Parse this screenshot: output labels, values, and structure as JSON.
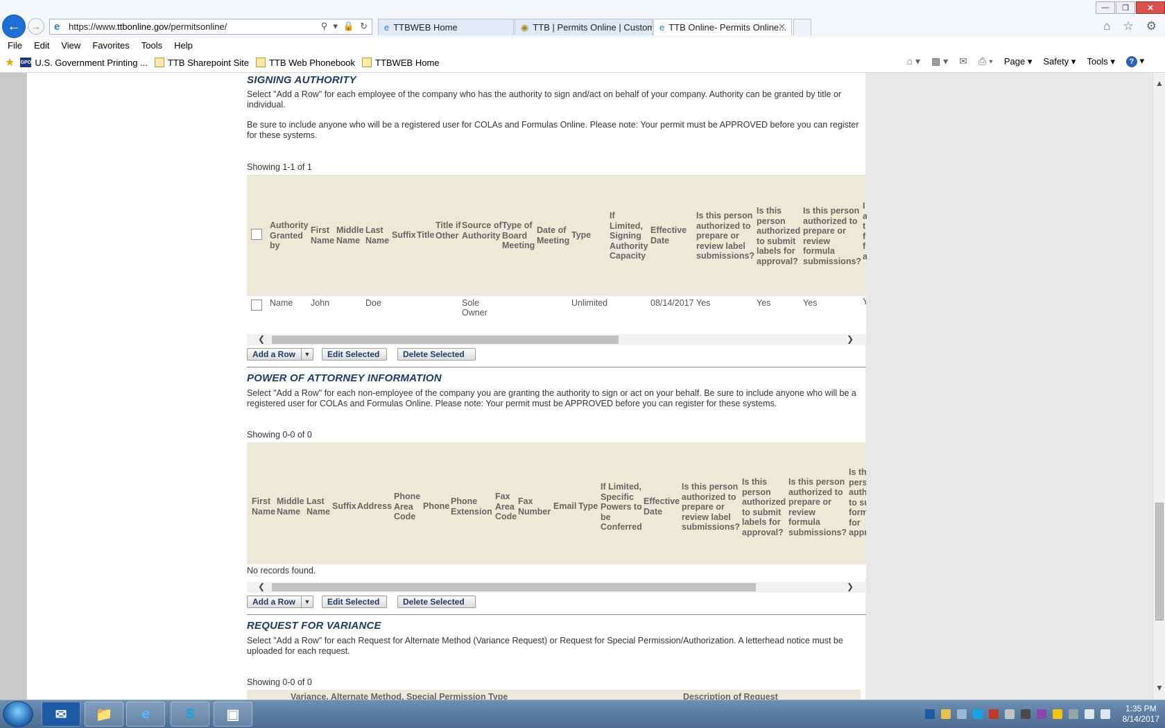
{
  "browser": {
    "url_prefix": "https://www.",
    "url_domain": "ttbonline.gov",
    "url_path": "/permitsonline/",
    "tabs": [
      {
        "label": "TTBWEB Home"
      },
      {
        "label": "TTB | Permits Online | Custom..."
      },
      {
        "label": "TTB Online- Permits Online..."
      }
    ],
    "menu": [
      "File",
      "Edit",
      "View",
      "Favorites",
      "Tools",
      "Help"
    ],
    "favorites": [
      {
        "label": "U.S. Government Printing ..."
      },
      {
        "label": "TTB Sharepoint Site"
      },
      {
        "label": "TTB Web Phonebook"
      },
      {
        "label": "TTBWEB Home"
      }
    ],
    "gpo_badge": "GPO",
    "commands": [
      "Page",
      "Safety",
      "Tools"
    ]
  },
  "signing": {
    "title": "SIGNING AUTHORITY",
    "para1": "Select \"Add a Row\" for each employee of the company who has the authority to sign and/act on behalf of your company. Authority can be granted by title or individual.",
    "para2": "Be sure to include anyone who will be a registered user for COLAs and Formulas Online. Please note: Your permit must be APPROVED before you can register for these systems.",
    "showing": "Showing 1-1 of 1",
    "headers": {
      "granted_by": "Authority Granted by",
      "first": "First Name",
      "middle": "Middle Name",
      "last": "Last Name",
      "suffix": "Suffix",
      "title": "Title",
      "title_other": "Title if Other",
      "source": "Source of Authority",
      "board": "Type of Board Meeting",
      "date_meeting": "Date of Meeting",
      "type": "Type",
      "capacity": "If Limited, Signing Authority Capacity",
      "effective": "Effective Date",
      "q_review": "Is this person authorized to prepare or review label submissions?",
      "q_submit": "Is this person authorized to submit labels for approval?",
      "q_formula": "Is this person authorized to prepare or review formula submissions?",
      "q_more": "I a t f f a"
    },
    "row": {
      "granted_by": "Name",
      "first": "John",
      "last": "Doe",
      "source": "Sole Owner",
      "type": "Unlimited",
      "effective": "08/14/2017",
      "q_review": "Yes",
      "q_submit": "Yes",
      "q_formula": "Yes",
      "q_more": "Y"
    },
    "buttons": {
      "add": "Add a Row",
      "edit": "Edit Selected",
      "delete": "Delete Selected"
    }
  },
  "poa": {
    "title": "POWER OF ATTORNEY INFORMATION",
    "para": "Select \"Add a Row\" for each non-employee of the company you are granting the authority to sign or act on your behalf. Be sure to include anyone who will be a registered user for COLAs and Formulas Online. Please note: Your permit must be APPROVED before you can register for these systems.",
    "showing": "Showing 0-0 of 0",
    "headers": {
      "first": "First Name",
      "middle": "Middle Name",
      "last": "Last Name",
      "suffix": "Suffix",
      "address": "Address",
      "phone_area": "Phone Area Code",
      "phone": "Phone",
      "phone_ext": "Phone Extension",
      "fax_area": "Fax Area Code",
      "fax": "Fax Number",
      "email": "Email",
      "type": "Type",
      "powers": "If Limited, Specific Powers to be Conferred",
      "effective": "Effective Date",
      "q_review": "Is this person authorized to prepare or review label submissions?",
      "q_submit": "Is this person authorized to submit labels for approval?",
      "q_formula": "Is this person authorized to prepare or review formula submissions?",
      "q_more": "Is this person authorized to submit formulas for approval?"
    },
    "no_records": "No records found.",
    "buttons": {
      "add": "Add a Row",
      "edit": "Edit Selected",
      "delete": "Delete Selected"
    }
  },
  "variance": {
    "title": "REQUEST FOR VARIANCE",
    "para": "Select \"Add a Row\" for each Request for Alternate Method (Variance Request) or Request for Special Permission/Authorization. A letterhead notice must be uploaded for each request.",
    "showing": "Showing 0-0 of 0",
    "headers": {
      "type": "Variance, Alternate Method, Special Permission Type",
      "description": "Description of Request"
    }
  },
  "taskbar": {
    "time": "1:35 PM",
    "date": "8/14/2017"
  }
}
